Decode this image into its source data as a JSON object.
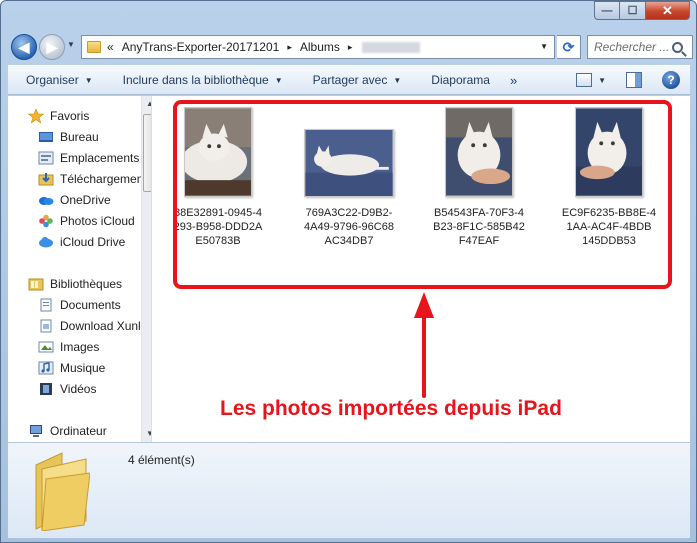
{
  "window": {
    "buttons": {
      "minimize": "—",
      "maximize": "☐",
      "close": "✕"
    }
  },
  "nav": {
    "back_icon": "back-arrow-icon",
    "forward_icon": "forward-arrow-icon",
    "address": {
      "prefix": "«",
      "crumbs": [
        "AnyTrans-Exporter-20171201",
        "Albums"
      ],
      "separator": "▸"
    },
    "search_placeholder": "Rechercher ..."
  },
  "toolbar": {
    "items": [
      {
        "label": "Organiser",
        "has_caret": true
      },
      {
        "label": "Inclure dans la bibliothèque",
        "has_caret": true
      },
      {
        "label": "Partager avec",
        "has_caret": true
      },
      {
        "label": "Diaporama",
        "has_caret": false
      }
    ],
    "more": "»",
    "help": "?"
  },
  "sidebar": {
    "items": [
      {
        "label": "Favoris",
        "icon": "star-icon"
      },
      {
        "label": "Bureau",
        "icon": "desktop-icon"
      },
      {
        "label": "Emplacements",
        "icon": "recent-places-icon"
      },
      {
        "label": "Téléchargements",
        "icon": "downloads-icon"
      },
      {
        "label": "OneDrive",
        "icon": "onedrive-icon"
      },
      {
        "label": "Photos iCloud",
        "icon": "icloud-photos-icon"
      },
      {
        "label": "iCloud Drive",
        "icon": "icloud-drive-icon"
      },
      {
        "label": "Bibliothèques",
        "icon": "libraries-icon"
      },
      {
        "label": "Documents",
        "icon": "documents-icon"
      },
      {
        "label": "Download Xunlei",
        "icon": "download-folder-icon"
      },
      {
        "label": "Images",
        "icon": "images-icon"
      },
      {
        "label": "Musique",
        "icon": "music-icon"
      },
      {
        "label": "Vidéos",
        "icon": "videos-icon"
      },
      {
        "label": "Ordinateur",
        "icon": "computer-icon"
      }
    ]
  },
  "files": [
    {
      "name": "88E32891-0945-4293-B958-DDD2AE50783B",
      "lines": [
        "88E32891-0945-4",
        "293-B958-DDD2A",
        "E50783B"
      ]
    },
    {
      "name": "769A3C22-D9B2-4A49-9796-96C68AC34DB7",
      "lines": [
        "769A3C22-D9B2-",
        "4A49-9796-96C68",
        "AC34DB7"
      ]
    },
    {
      "name": "B54543FA-70F3-4B23-8F1C-585B42F47EAF",
      "lines": [
        "B54543FA-70F3-4",
        "B23-8F1C-585B42",
        "F47EAF"
      ]
    },
    {
      "name": "EC9F6235-BB8E-41AA-AC4F-4BDB145DDB53",
      "lines": [
        "EC9F6235-BB8E-4",
        "1AA-AC4F-4BDB",
        "145DDB53"
      ]
    }
  ],
  "annotation": "Les photos importées depuis iPad",
  "details": {
    "count": "4 élément(s)"
  },
  "colors": {
    "annotation_red": "#e8141b",
    "accent": "#1e395b"
  }
}
